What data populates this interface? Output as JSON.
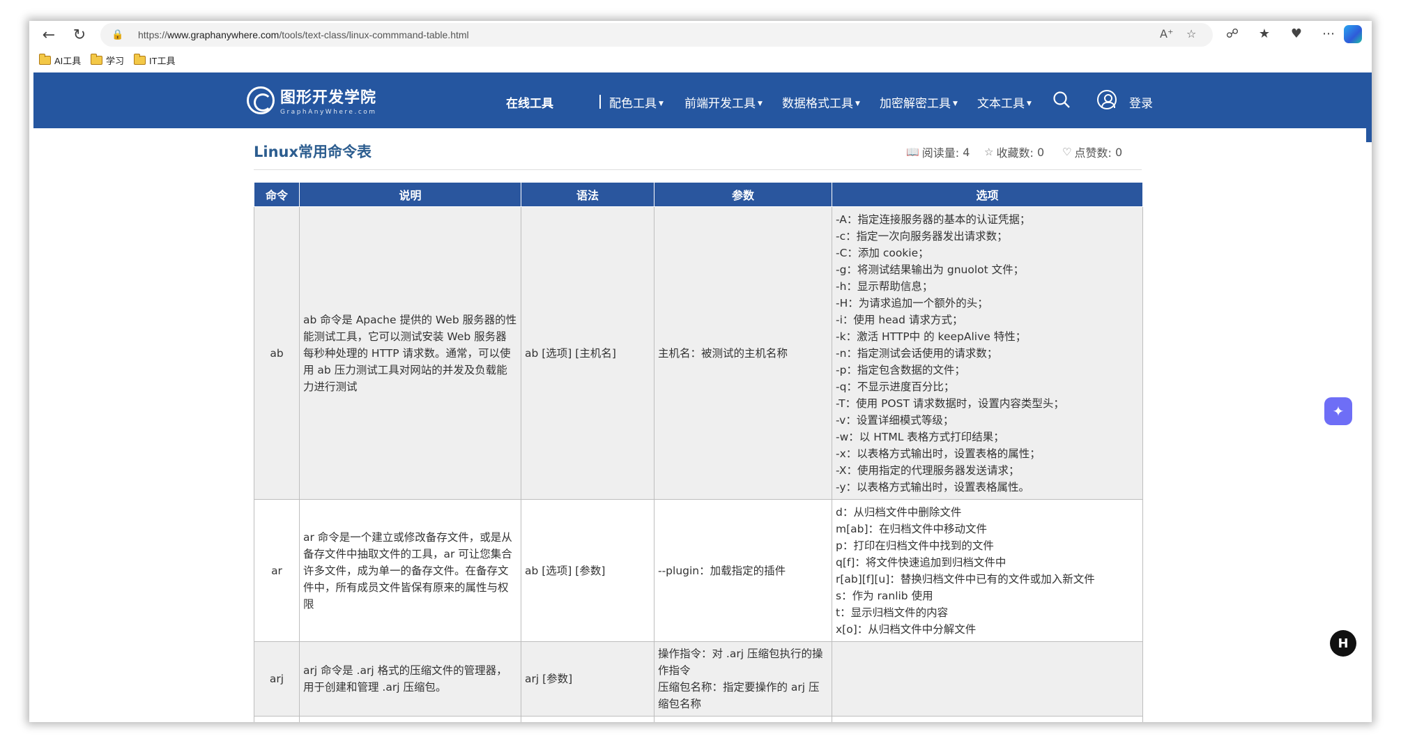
{
  "browser": {
    "url_prefix": "https://",
    "url_host": "www.graphanywhere.com",
    "url_path": "/tools/text-class/linux-commmand-table.html",
    "bookmarks": [
      "AI工具",
      "学习",
      "IT工具"
    ]
  },
  "header": {
    "logo_title": "图形开发学院",
    "logo_subtitle": "GraphAnyWhere.com",
    "nav": [
      "在线工具",
      "配色工具",
      "前端开发工具",
      "数据格式工具",
      "加密解密工具",
      "文本工具"
    ],
    "login": "登录",
    "brand_color": "#2556a0"
  },
  "page": {
    "title": "Linux常用命令表",
    "stats": {
      "views_label": "阅读量:",
      "views": "4",
      "favorites_label": "收藏数:",
      "favorites": "0",
      "likes_label": "点赞数:",
      "likes": "0"
    }
  },
  "table": {
    "headers": [
      "命令",
      "说明",
      "语法",
      "参数",
      "选项"
    ],
    "rows": [
      {
        "command": "ab",
        "description": [
          "ab 命令是 Apache 提供的 Web 服务器的性",
          "能测试工具，它可以测试安装 Web 服务器",
          "每秒种处理的 HTTP 请求数。通常，可以使",
          "用 ab 压力测试工具对网站的并发及负载能",
          "力进行测试"
        ],
        "syntax": "ab [选项] [主机名]",
        "params": [
          "主机名：被测试的主机名称"
        ],
        "options": [
          "-A：指定连接服务器的基本的认证凭据；",
          "-c：指定一次向服务器发出请求数；",
          "-C：添加 cookie；",
          "-g：将测试结果输出为 gnuolot 文件；",
          "-h：显示帮助信息；",
          "-H：为请求追加一个额外的头；",
          "-i：使用 head 请求方式；",
          "-k：激活 HTTP中 的 keepAlive 特性；",
          "-n：指定测试会话使用的请求数；",
          "-p：指定包含数据的文件；",
          "-q：不显示进度百分比；",
          "-T：使用 POST 请求数据时，设置内容类型头；",
          "-v：设置详细模式等级；",
          "-w：以 HTML 表格方式打印结果；",
          "-x：以表格方式输出时，设置表格的属性；",
          "-X：使用指定的代理服务器发送请求；",
          "-y：以表格方式输出时，设置表格属性。"
        ]
      },
      {
        "command": "ar",
        "description": [
          "ar 命令是一个建立或修改备存文件，或是从",
          "备存文件中抽取文件的工具，ar 可让您集合",
          "许多文件，成为单一的备存文件。在备存文",
          "件中，所有成员文件皆保有原来的属性与权",
          "限"
        ],
        "syntax": "ab [选项] [参数]",
        "params": [
          "--plugin：加载指定的插件"
        ],
        "options": [
          "d：从归档文件中删除文件",
          "m[ab]：在归档文件中移动文件",
          "p：打印在归档文件中找到的文件",
          "q[f]：将文件快速追加到归档文件中",
          "r[ab][f][u]：替换归档文件中已有的文件或加入新文件",
          "s：作为 ranlib 使用",
          "t：显示归档文件的内容",
          "x[o]：从归档文件中分解文件"
        ]
      },
      {
        "command": "arj",
        "description": [
          "arj 命令是 .arj 格式的压缩文件的管理器，",
          "用于创建和管理 .arj 压缩包。"
        ],
        "syntax": "arj [参数]",
        "params": [
          "操作指令：对 .arj 压缩包执行的操",
          "作指令",
          "压缩包名称：指定要操作的 arj 压",
          "缩包名称"
        ],
        "options": []
      }
    ]
  }
}
